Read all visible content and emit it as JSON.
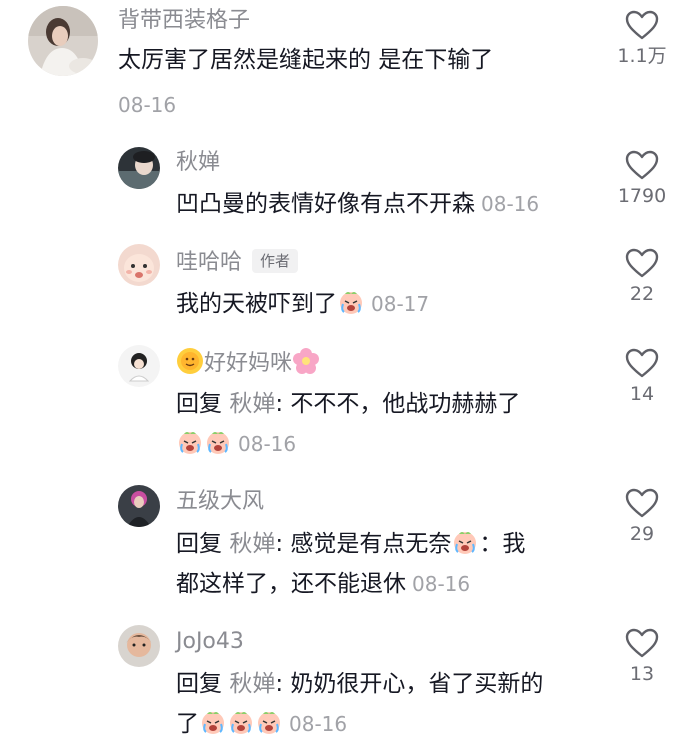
{
  "comments": [
    {
      "username": "背带西装格子",
      "text": "太厉害了居然是缝起来的 是在下输了",
      "time": "08-16",
      "likes": "1.1万"
    }
  ],
  "replies": [
    {
      "username": "秋婵",
      "text": "凹凸曼的表情好像有点不开森",
      "time": "08-16",
      "likes": "1790"
    },
    {
      "username": "哇哈哈",
      "badge": "作者",
      "text": "我的天被吓到了",
      "emoji": "crying-face",
      "time": "08-17",
      "likes": "22"
    },
    {
      "username": "好好妈咪",
      "name_emojis": [
        "sun-emoji",
        "flower-emoji"
      ],
      "reply_prefix": "回复",
      "reply_to": "秋婵",
      "text": ": 不不不，他战功赫赫了",
      "emoji": "crying-face x2",
      "time": "08-16",
      "likes": "14"
    },
    {
      "username": "五级大风",
      "reply_prefix": "回复",
      "reply_to": "秋婵",
      "text_before": ": 感觉是有点无奈",
      "text_after": "：我",
      "text_line2": "都这样了，还不能退休",
      "emoji": "crying-face",
      "time": "08-16",
      "likes": "29"
    },
    {
      "username": "JoJo43",
      "reply_prefix": "回复",
      "reply_to": "秋婵",
      "text": ": 奶奶很开心，省了买新的",
      "text_line2": "了",
      "emoji": "crying-face x3",
      "time": "08-16",
      "likes": "13"
    }
  ],
  "icons": {
    "like": "heart-outline-icon"
  },
  "colors": {
    "text": "#161823",
    "secondary": "#8a8b91",
    "muted": "#a1a2a7"
  }
}
